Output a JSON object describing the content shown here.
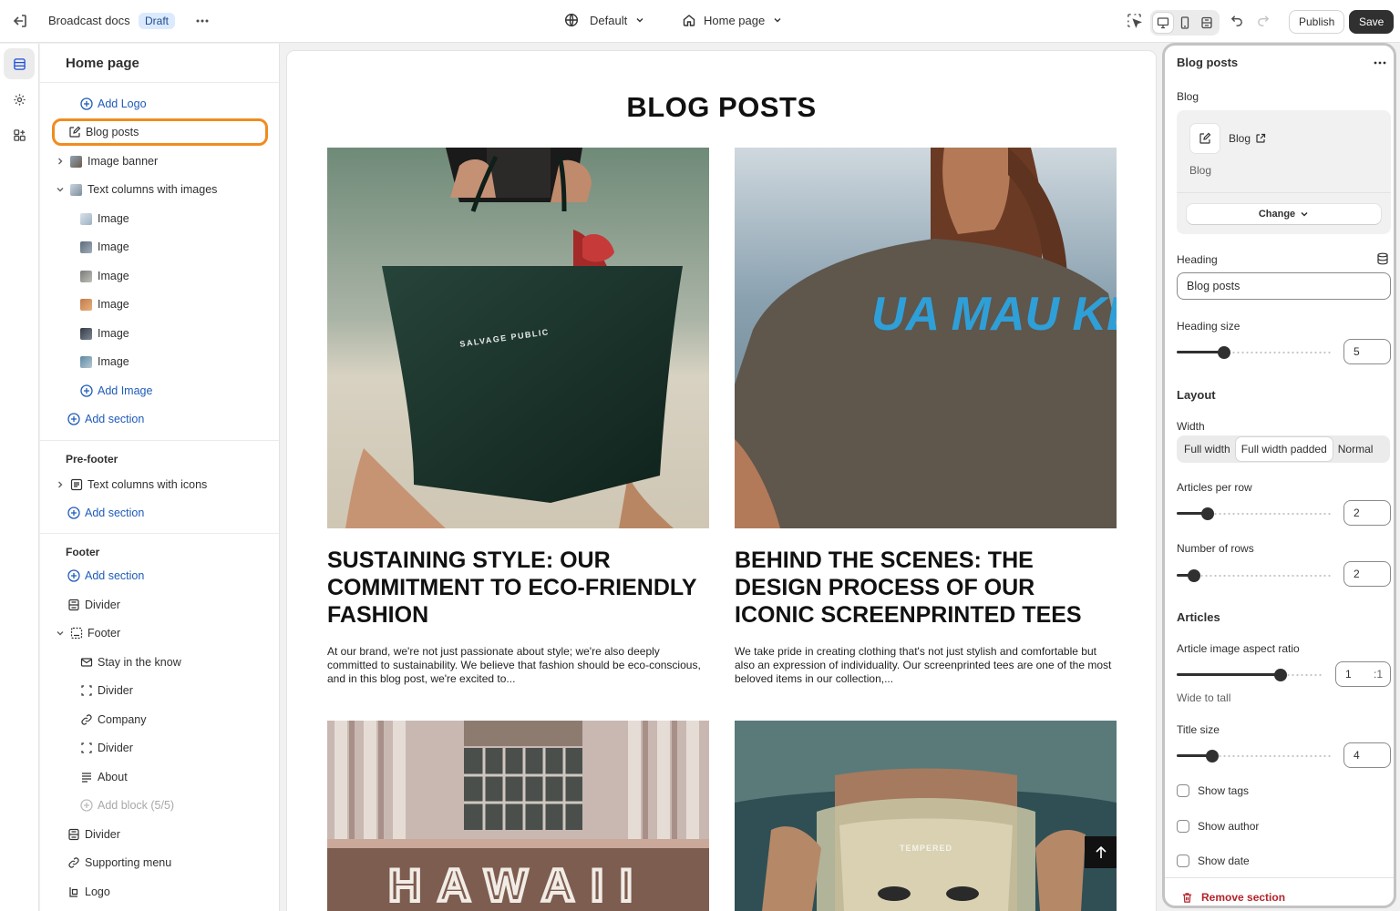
{
  "topbar": {
    "store_name": "Broadcast docs",
    "status_badge": "Draft",
    "theme_select": "Default",
    "page_select": "Home page",
    "publish_label": "Publish",
    "save_label": "Save"
  },
  "sidebar": {
    "title": "Home page",
    "items": [
      {
        "label": "Add Logo"
      },
      {
        "label": "Blog posts"
      },
      {
        "label": "Image banner"
      },
      {
        "label": "Text columns with images"
      },
      {
        "label": "Image"
      },
      {
        "label": "Image"
      },
      {
        "label": "Image"
      },
      {
        "label": "Image"
      },
      {
        "label": "Image"
      },
      {
        "label": "Image"
      },
      {
        "label": "Add Image"
      },
      {
        "label": "Add section"
      }
    ],
    "prefooter": {
      "heading": "Pre-footer",
      "items": [
        {
          "label": "Text columns with icons"
        },
        {
          "label": "Add section"
        }
      ]
    },
    "footer": {
      "heading": "Footer",
      "items": [
        {
          "label": "Add section"
        },
        {
          "label": "Divider"
        },
        {
          "label": "Footer"
        },
        {
          "label": "Stay in the know"
        },
        {
          "label": "Divider"
        },
        {
          "label": "Company"
        },
        {
          "label": "Divider"
        },
        {
          "label": "About"
        },
        {
          "label": "Add block (5/5)"
        },
        {
          "label": "Divider"
        },
        {
          "label": "Supporting menu"
        },
        {
          "label": "Logo"
        }
      ]
    }
  },
  "preview": {
    "heading": "BLOG POSTS",
    "articles": [
      {
        "title": "SUSTAINING STYLE: OUR COMMITMENT TO ECO-FRIENDLY FASHION",
        "excerpt": "At our brand, we're not just passionate about style; we're also deeply committed to sustainability. We believe that fashion should be eco-conscious, and in this blog post, we're excited to...",
        "image_text": "SALVAGE PUBLIC"
      },
      {
        "title": "BEHIND THE SCENES: THE DESIGN PROCESS OF OUR ICONIC SCREENPRINTED TEES",
        "excerpt": "We take pride in creating clothing that's not just stylish and comfortable but also an expression of individuality. Our screenprinted tees are one of the most beloved items in our collection,...",
        "image_text": "UA MAU KE EA O KA 'ĀINA I KA PONO"
      },
      {
        "image_text": "HAWAII"
      },
      {
        "image_text": "TEMPERED"
      }
    ]
  },
  "settings": {
    "title": "Blog posts",
    "blog_label": "Blog",
    "blog_name": "Blog",
    "blog_sub": "Blog",
    "change_label": "Change",
    "heading_label": "Heading",
    "heading_value": "Blog posts",
    "heading_size_label": "Heading size",
    "heading_size": 5,
    "layout_label": "Layout",
    "width_label": "Width",
    "width_options": [
      "Full width",
      "Full width padded",
      "Normal"
    ],
    "width_selected": "Full width padded",
    "articles_per_row_label": "Articles per row",
    "articles_per_row": 2,
    "rows_label": "Number of rows",
    "rows": 2,
    "articles_label": "Articles",
    "aspect_label": "Article image aspect ratio",
    "aspect_value": "1",
    "aspect_suffix": ":1",
    "aspect_hint": "Wide to tall",
    "title_size_label": "Title size",
    "title_size": 4,
    "show_tags": "Show tags",
    "show_author": "Show author",
    "show_date": "Show date",
    "remove_label": "Remove section"
  },
  "colors": {
    "accent": "#1e5bb8",
    "highlight": "#f08c1e",
    "danger": "#b4232a",
    "dark": "#303030"
  }
}
